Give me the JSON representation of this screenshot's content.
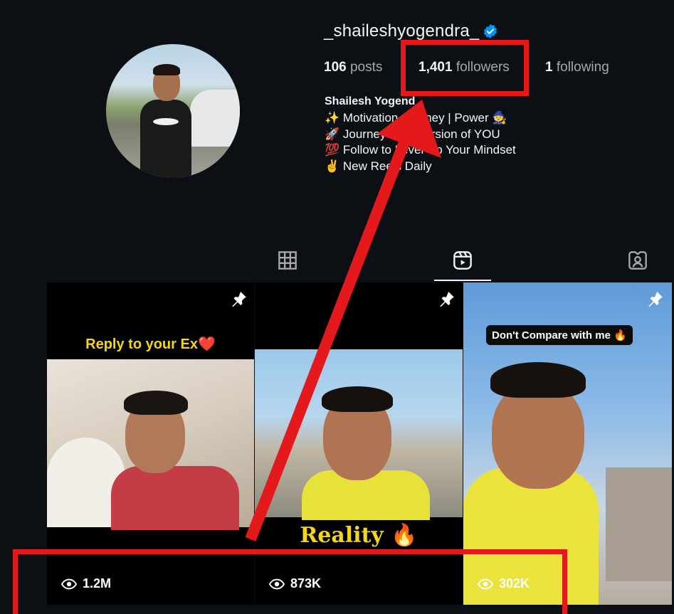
{
  "profile": {
    "username": "_shaileshyogendra_",
    "stats": {
      "posts_count": "106",
      "posts_label": "posts",
      "followers_count": "1,401",
      "followers_label": "followers",
      "following_count": "1",
      "following_label": "following"
    },
    "full_name": "Shailesh Yogend",
    "bio_lines": [
      "✨ Motivation Journey | Power 🧙",
      "🚀 Journey Best Version of YOU",
      "💯 Follow to Level Up Your Mindset",
      "✌️ New Reels Daily"
    ]
  },
  "tabs": [
    {
      "name": "posts-grid",
      "active": false
    },
    {
      "name": "reels",
      "active": true
    },
    {
      "name": "tagged",
      "active": false
    }
  ],
  "reels": [
    {
      "caption": "Reply to your Ex❤️",
      "views": "1.2M",
      "pinned": true
    },
    {
      "caption": "Reality 🔥",
      "views": "873K",
      "pinned": true
    },
    {
      "caption": "Don't Compare with me 🔥",
      "views": "302K",
      "pinned": true
    }
  ],
  "colors": {
    "background": "#0c1014",
    "annotation_red": "#e3191b",
    "verified_blue": "#0095f6"
  }
}
